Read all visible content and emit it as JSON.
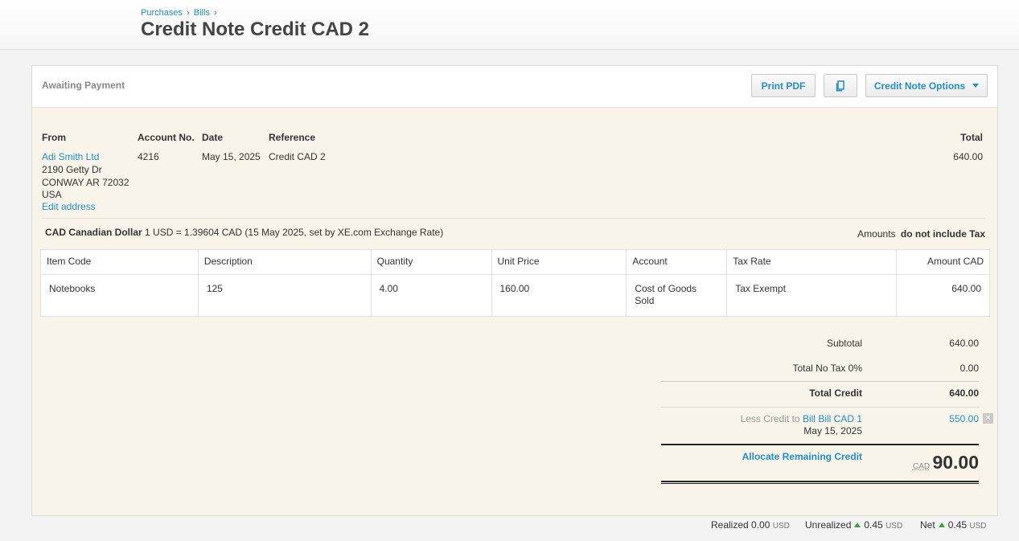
{
  "breadcrumb": {
    "items": [
      "Purchases",
      "Bills"
    ],
    "separator": "›"
  },
  "title": "Credit Note Credit CAD 2",
  "toolbar": {
    "status": "Awaiting Payment",
    "print_pdf": "Print PDF",
    "copy_icon": "copy-icon",
    "options": "Credit Note Options"
  },
  "details": {
    "from_label": "From",
    "from_name": "Adi Smith Ltd",
    "address_line1": "2190 Getty Dr",
    "address_line2": "CONWAY AR 72032",
    "address_line3": "USA",
    "edit_address": "Edit address",
    "account_label": "Account No.",
    "account_value": "4216",
    "date_label": "Date",
    "date_value": "May 15, 2025",
    "reference_label": "Reference",
    "reference_value": "Credit CAD 2",
    "total_label": "Total",
    "total_value": "640.00"
  },
  "currency": {
    "name": "CAD Canadian Dollar",
    "rate_text": "1 USD = 1.39604 CAD (15 May 2025, set by XE.com Exchange Rate)",
    "amounts_label": "Amounts",
    "amounts_value": "do not include Tax"
  },
  "items": {
    "headers": [
      "Item Code",
      "Description",
      "Quantity",
      "Unit Price",
      "Account",
      "Tax Rate",
      "Amount CAD"
    ],
    "rows": [
      {
        "item_code": "Notebooks",
        "description": "125",
        "quantity": "4.00",
        "unit_price": "160.00",
        "account": "Cost of Goods Sold",
        "tax_rate": "Tax Exempt",
        "amount": "640.00"
      }
    ]
  },
  "totals": {
    "subtotal_label": "Subtotal",
    "subtotal_value": "640.00",
    "notax_label": "Total No Tax 0%",
    "notax_value": "0.00",
    "total_credit_label": "Total Credit",
    "total_credit_value": "640.00",
    "less_credit_prefix": "Less Credit to",
    "less_credit_link1": "Bill",
    "less_credit_link2": "Bill CAD 1",
    "less_credit_date": "May 15, 2025",
    "less_credit_value": "550.00",
    "allocate_label": "Allocate Remaining Credit",
    "remaining_currency": "CAD",
    "remaining_value": "90.00"
  },
  "footer": {
    "realized_label": "Realized",
    "realized_value": "0.00",
    "unrealized_label": "Unrealized",
    "unrealized_value": "0.45",
    "net_label": "Net",
    "net_value": "0.45",
    "unit": "USD"
  },
  "colors": {
    "link": "#1f8fc6",
    "panel_bg": "#f8f4ea",
    "gain": "#3aa335"
  }
}
